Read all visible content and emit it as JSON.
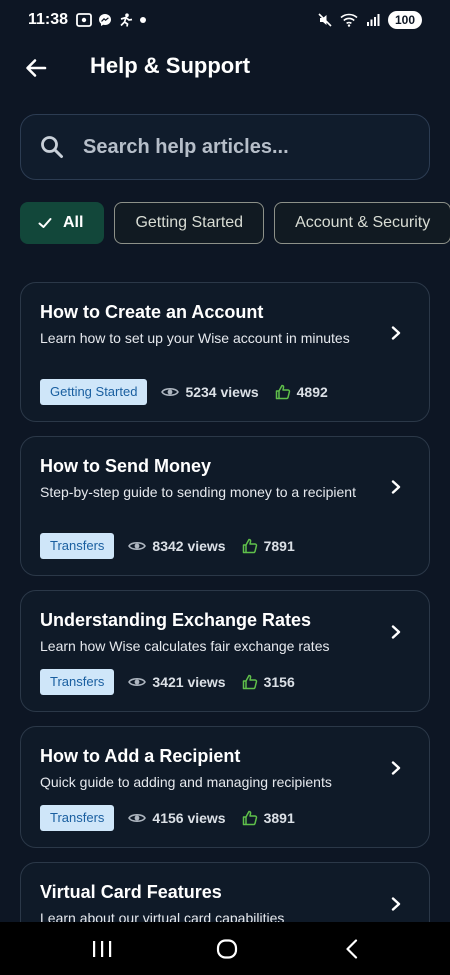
{
  "status_bar": {
    "time": "11:38",
    "battery": "100"
  },
  "header": {
    "title": "Help & Support"
  },
  "search": {
    "placeholder": "Search help articles..."
  },
  "chips": [
    {
      "label": "All",
      "selected": true
    },
    {
      "label": "Getting Started",
      "selected": false
    },
    {
      "label": "Account & Security",
      "selected": false
    }
  ],
  "articles": [
    {
      "title": "How to Create an Account",
      "description": "Learn how to set up your Wise account in minutes",
      "category": "Getting Started",
      "views": "5234 views",
      "likes": "4892"
    },
    {
      "title": "How to Send Money",
      "description": "Step-by-step guide to sending money to a recipient",
      "category": "Transfers",
      "views": "8342 views",
      "likes": "7891"
    },
    {
      "title": "Understanding Exchange Rates",
      "description": "Learn how Wise calculates fair exchange rates",
      "category": "Transfers",
      "views": "3421 views",
      "likes": "3156"
    },
    {
      "title": "How to Add a Recipient",
      "description": "Quick guide to adding and managing recipients",
      "category": "Transfers",
      "views": "4156 views",
      "likes": "3891"
    },
    {
      "title": "Virtual Card Features",
      "description": "Learn about our virtual card capabilities",
      "category": "",
      "views": "",
      "likes": ""
    }
  ],
  "colors": {
    "background": "#0d1624",
    "card": "#0f1a28",
    "chip_selected": "#12473a",
    "tag_bg": "#cfe6f9",
    "tag_text": "#1a5fa0",
    "like_icon": "#5fbf4a"
  },
  "icons": {
    "back": "arrow-left-icon",
    "search": "search-icon",
    "check": "check-icon",
    "views": "eye-icon",
    "likes": "thumbs-up-icon",
    "chevron": "chevron-right-icon"
  }
}
